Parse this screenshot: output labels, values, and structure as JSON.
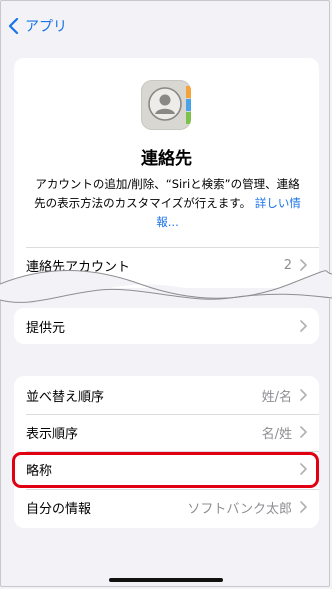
{
  "nav": {
    "back_label": "アプリ"
  },
  "app": {
    "title": "連絡先",
    "description": "アカウントの追加/削除、“Siriと検索”の管理、連絡先の表示方法のカスタマイズが行えます。",
    "link_text": "詳しい情報..."
  },
  "accounts_row": {
    "label": "連絡先アカウント",
    "value": "2"
  },
  "provider_row": {
    "label": "提供元"
  },
  "settings": [
    {
      "label": "並べ替え順序",
      "value": "姓/名"
    },
    {
      "label": "表示順序",
      "value": "名/姓"
    },
    {
      "label": "略称",
      "value": ""
    },
    {
      "label": "自分の情報",
      "value": "ソフトバンク太郎"
    }
  ],
  "colors": {
    "accent": "#1a73e8",
    "highlight": "#e00012",
    "background": "#f2f2f7"
  }
}
